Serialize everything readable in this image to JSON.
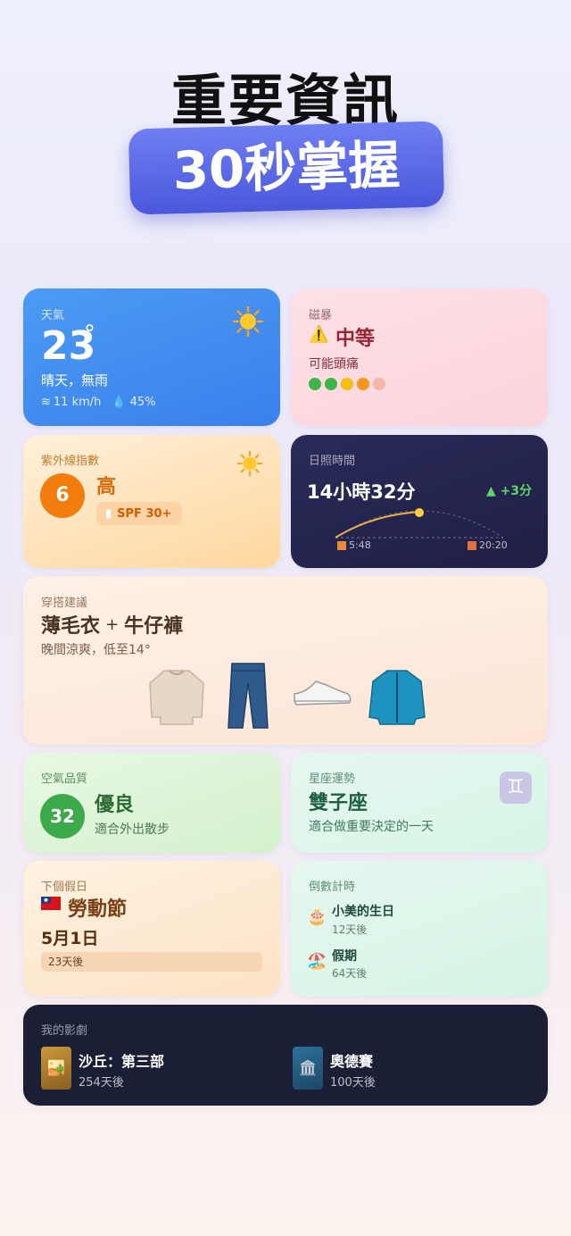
{
  "hero": {
    "line1": "重要資訊",
    "line2": "30秒掌握"
  },
  "weather": {
    "label": "天氣",
    "temp": "23",
    "degree": "°",
    "desc": "晴天，無雨",
    "wind": "11 km/h",
    "humidity": "45%"
  },
  "magnetic": {
    "label": "磁暴",
    "level": "中等",
    "warn_icon": "⚠️",
    "note": "可能頭痛",
    "dot_colors": [
      "#3cb54a",
      "#3cb54a",
      "#f5bd10",
      "#f5961e",
      "#f5b5a8"
    ]
  },
  "uv": {
    "label": "紫外線指數",
    "index": "6",
    "level": "高",
    "spf": "SPF 30+"
  },
  "daylight": {
    "label": "日照時間",
    "duration": "14小時32分",
    "change": "▲ +3分",
    "sunrise": "5:48",
    "sunset": "20:20"
  },
  "outfit": {
    "label": "穿搭建議",
    "title_a": "薄毛衣",
    "plus": "+",
    "title_b": "牛仔褲",
    "note": "晚間涼爽，低至14°"
  },
  "air": {
    "label": "空氣品質",
    "aqi": "32",
    "level": "優良",
    "note": "適合外出散步"
  },
  "horoscope": {
    "label": "星座運勢",
    "sign": "雙子座",
    "note": "適合做重要決定的一天",
    "symbol": "♊"
  },
  "holiday": {
    "label": "下個假日",
    "flag": "🇹🇼",
    "name": "勞動節",
    "date": "5月1日",
    "days": "23天後"
  },
  "countdown": {
    "label": "倒數計時",
    "items": [
      {
        "icon": "🎂",
        "title": "小美的生日",
        "days": "12天後"
      },
      {
        "icon": "🏖️",
        "title": "假期",
        "days": "64天後"
      }
    ]
  },
  "shows": {
    "label": "我的影劇",
    "items": [
      {
        "icon": "🏜️",
        "title": "沙丘：第三部",
        "days": "254天後"
      },
      {
        "icon": "🏛️",
        "title": "奧德賽",
        "days": "100天後"
      }
    ]
  },
  "colors": {
    "accent": "#4a57dc",
    "weather_blue": "#3a80ec",
    "uv_orange": "#f27d0c",
    "air_green": "#3ca94a"
  }
}
